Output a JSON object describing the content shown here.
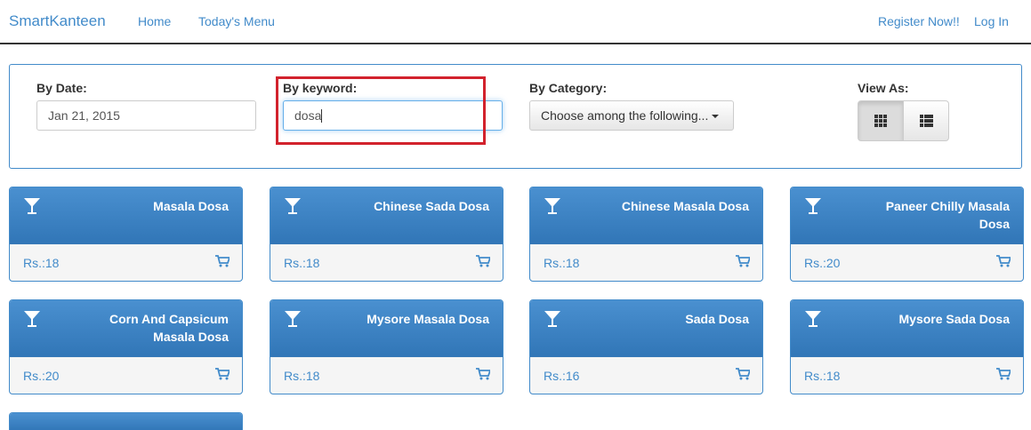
{
  "navbar": {
    "brand": "SmartKanteen",
    "links": [
      "Home",
      "Today's Menu"
    ],
    "register": "Register Now!!",
    "login": "Log In"
  },
  "filters": {
    "date_label": "By Date:",
    "date_value": "Jan 21, 2015",
    "keyword_label": "By keyword:",
    "keyword_value": "dosa",
    "category_label": "By Category:",
    "category_selected": "Choose among the following...",
    "view_label": "View As:"
  },
  "icons": {
    "item_icon": "cocktail-glass-icon",
    "cart_icon": "shopping-cart-icon",
    "grid_view": "grid-icon",
    "list_view": "list-icon"
  },
  "colors": {
    "accent": "#428bca",
    "card_header": "#3a80c2",
    "highlight": "#d2222d"
  },
  "items": [
    {
      "name": "Masala Dosa",
      "price": "Rs.:18"
    },
    {
      "name": "Chinese Sada Dosa",
      "price": "Rs.:18"
    },
    {
      "name": "Chinese Masala Dosa",
      "price": "Rs.:18"
    },
    {
      "name": "Paneer Chilly Masala Dosa",
      "price": "Rs.:20"
    },
    {
      "name": "Corn And Capsicum Masala Dosa",
      "price": "Rs.:20"
    },
    {
      "name": "Mysore Masala Dosa",
      "price": "Rs.:18"
    },
    {
      "name": "Sada Dosa",
      "price": "Rs.:16"
    },
    {
      "name": "Mysore Sada Dosa",
      "price": "Rs.:18"
    }
  ]
}
